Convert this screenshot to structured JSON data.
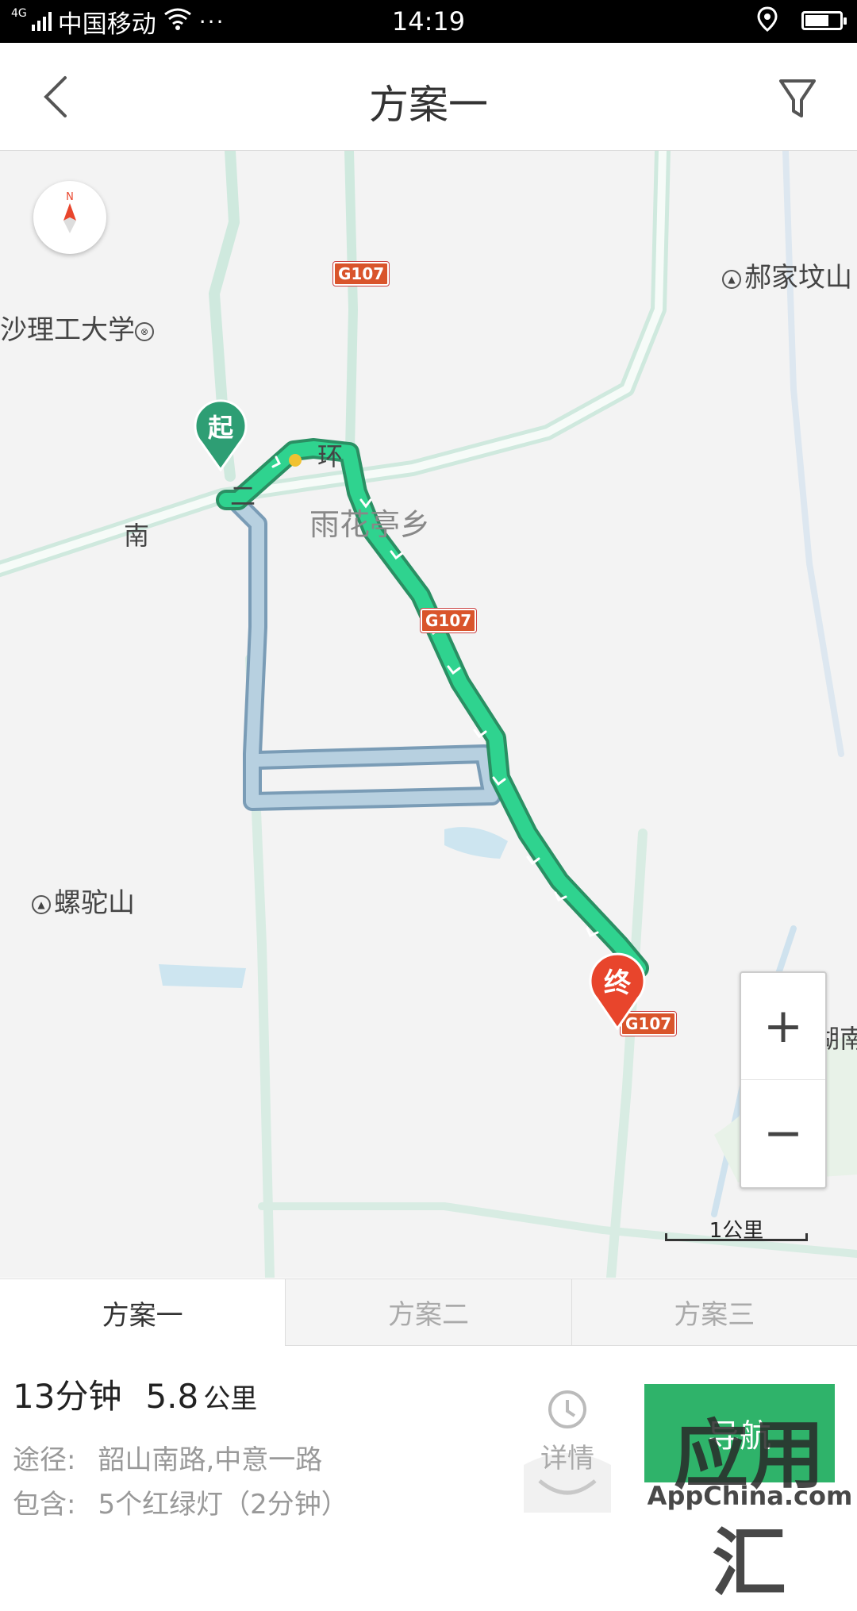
{
  "status_bar": {
    "network": "4G",
    "carrier": "中国移动",
    "more": "···",
    "time": "14:19",
    "battery_level": 0.7
  },
  "header": {
    "title": "方案一"
  },
  "map": {
    "labels": {
      "university": "沙理工大学",
      "haojia": "郝家坟山",
      "nan": "南",
      "huan": "环",
      "yuhuating": "雨花亭乡",
      "luotuo": "螺驼山",
      "hunan": "湖南",
      "er": "二"
    },
    "road_shields": [
      "G107",
      "G107",
      "G107"
    ],
    "markers": {
      "start": "起",
      "end": "终"
    },
    "compass": "N",
    "scale": "1公里",
    "zoom_in": "+",
    "zoom_out": "−"
  },
  "tabs": [
    {
      "label": "方案一",
      "active": true
    },
    {
      "label": "方案二",
      "active": false
    },
    {
      "label": "方案三",
      "active": false
    }
  ],
  "route": {
    "duration": "13分钟",
    "distance_value": "5.8",
    "distance_unit": "公里",
    "via_label": "途径:",
    "via_value": "韶山南路,中意一路",
    "include_label": "包含:",
    "include_value": "5个红绿灯（2分钟）"
  },
  "actions": {
    "detail": "详情",
    "navigate": "导航"
  },
  "watermark": {
    "big": "应用汇",
    "small": "AppChina.com"
  },
  "colors": {
    "route_green": "#2fd38f",
    "alt_route": "#aacbe0",
    "start_marker": "#2e9e74",
    "end_marker": "#e8452c"
  }
}
